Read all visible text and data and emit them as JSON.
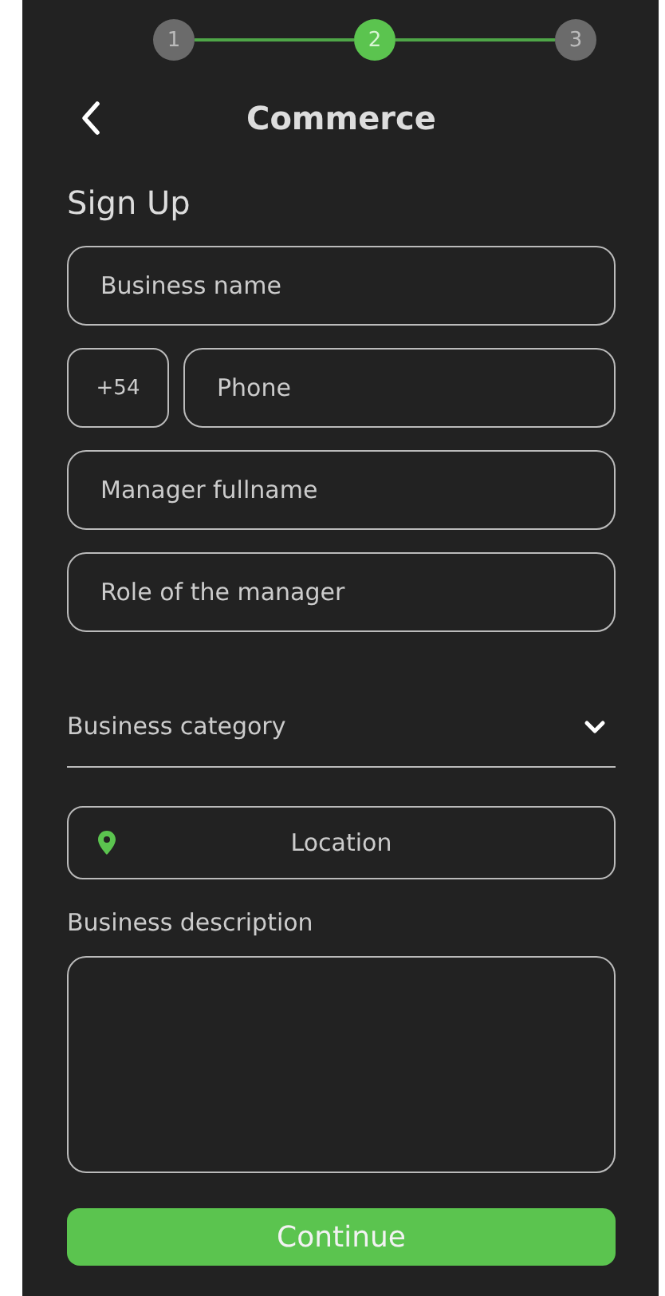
{
  "stepper": [
    {
      "label": "1",
      "selected": false
    },
    {
      "label": "2",
      "selected": true
    },
    {
      "label": "3",
      "selected": false
    }
  ],
  "header": {
    "title": "Commerce"
  },
  "heading": "Sign Up",
  "fields": [
    {
      "kind": "text",
      "placeholder": "Business name"
    },
    {
      "kind": "phone",
      "prefix": "+54",
      "placeholder": "Phone"
    },
    {
      "kind": "text",
      "placeholder": "Manager fullname"
    },
    {
      "kind": "text",
      "placeholder": "Role of the manager"
    },
    {
      "kind": "select",
      "placeholder": "Business category"
    },
    {
      "kind": "location",
      "label": "Location"
    },
    {
      "kind": "textarea",
      "label": "Business description"
    }
  ],
  "continue_button": "Continue"
}
